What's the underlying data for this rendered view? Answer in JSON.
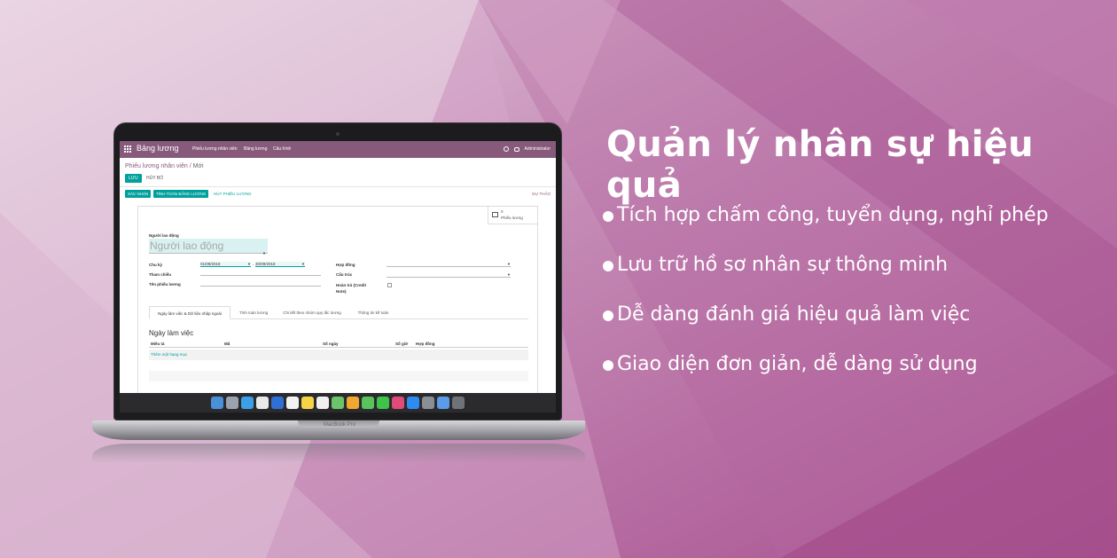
{
  "promo": {
    "title": "Quản lý nhân sự hiệu quả",
    "features": [
      "Tích hợp chấm công, tuyển dụng, nghỉ phép",
      "Lưu trữ hồ sơ nhân sự thông minh",
      "Dễ dàng đánh giá hiệu quả làm việc",
      "Giao diện đơn giản, dễ dàng sử dụng"
    ]
  },
  "device": {
    "model": "MacBook Pro"
  },
  "app": {
    "name": "Bảng lương",
    "menu": [
      "Phiếu lương nhân viên",
      "Bảng lương",
      "Cấu hình"
    ],
    "user": "Administrator",
    "notification_count": "2"
  },
  "form": {
    "breadcrumb": {
      "parent": "Phiếu lương nhân viên",
      "separator": "/",
      "current": "Mới"
    },
    "save_label": "LƯU",
    "discard_label": "HỦY BỎ",
    "status_buttons": [
      "XÁC NHẬN",
      "TÍNH TOÁN BẢNG LƯƠNG"
    ],
    "cancel_payslip_label": "HỦY PHIẾU LƯƠNG",
    "state": "DỰ THẢO",
    "smart_button": {
      "count": "0",
      "label": "Phiếu lương"
    },
    "employee": {
      "label": "Người lao động",
      "placeholder": "Người lao động"
    },
    "left_fields": {
      "period_label": "Chu kỳ",
      "date_from": "01/09/2018",
      "date_sep": "-",
      "date_to": "30/09/2018",
      "reference_label": "Tham chiếu",
      "name_label": "Tên phiếu lương"
    },
    "right_fields": {
      "contract_label": "Hợp đồng",
      "structure_label": "Cấu trúc",
      "refund_label_1": "Hoàn trả (Credit",
      "refund_label_2": "Note)"
    },
    "tabs": [
      "Ngày làm việc & Dữ liệu nhập ngoài",
      "Tính toán lương",
      "Chi tiết theo nhóm quy tắc lương",
      "Thông tin kế toán"
    ],
    "worked_days": {
      "title": "Ngày làm việc",
      "columns": [
        "Miêu tả",
        "Mã",
        "Số ngày",
        "Số giờ",
        "Hợp đồng"
      ],
      "add_line": "Thêm một hạng mục"
    }
  },
  "colors": {
    "brand": "#875a7b",
    "accent": "#00a09d",
    "background": "#c98ab8"
  }
}
